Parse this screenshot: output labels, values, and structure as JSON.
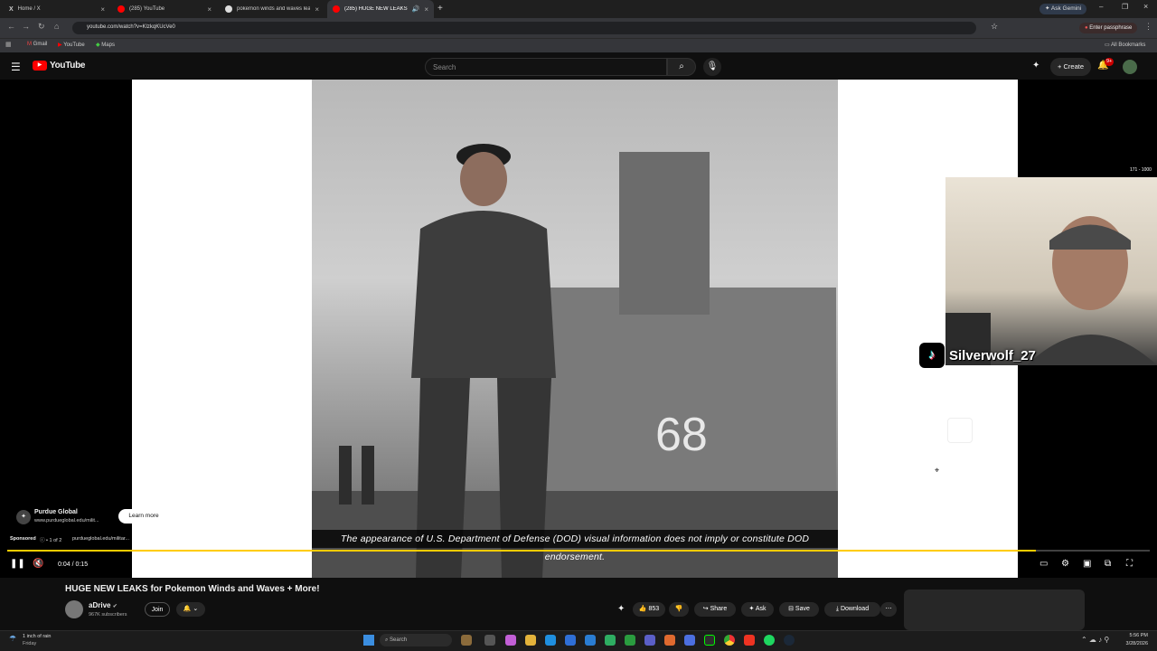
{
  "browser": {
    "tabs": [
      {
        "title": "Home / X",
        "icon": "x-logo-icon",
        "active": false
      },
      {
        "title": "(285) YouTube",
        "icon": "youtube-icon",
        "active": false
      },
      {
        "title": "pokemon winds and waves leak",
        "icon": "google-icon",
        "active": false
      },
      {
        "title": "(285) HUGE NEW LEAKS fo",
        "icon": "youtube-icon",
        "active": true
      }
    ],
    "new_tab": "+",
    "url": "youtube.com/watch?v=KlzkqKUcVe0",
    "gemini_label": "Ask Gemini",
    "passphrase_label": "Enter passphrase",
    "bookmarks": [
      "Gmail",
      "YouTube",
      "Maps"
    ],
    "all_bookmarks": "All Bookmarks"
  },
  "youtube": {
    "logo": "YouTube",
    "search_placeholder": "Search",
    "create_label": "Create",
    "notification_count": "9+"
  },
  "player": {
    "caption": "The appearance of U.S. Department of Defense (DOD) visual information does not imply or constitute DOD endorsement.",
    "time": "0:04 / 0:15",
    "progress": 0.9,
    "ad": {
      "advertiser": "Purdue Global",
      "ad_url": "www.purdueglobal.edu/milit...",
      "learn_more": "Learn more",
      "sponsored": "Sponsored",
      "ad_count": "1 of 2",
      "ad_domain": "purdueglobal.edu/militar..."
    },
    "overlay": {
      "streamer_name": "Silverwolf_27",
      "top_counter": "171 - 1000"
    }
  },
  "video": {
    "title": "HUGE NEW LEAKS for Pokemon Winds and Waves + More!",
    "channel": "aDrive",
    "subscribers": "967K subscribers",
    "join": "Join",
    "likes": "853",
    "share": "Share",
    "ask": "Ask",
    "save": "Save",
    "download": "Download"
  },
  "taskbar": {
    "weather": "1 inch of rain",
    "weather_day": "Friday",
    "search": "Search",
    "time": "5:56 PM",
    "date": "3/28/2026"
  }
}
